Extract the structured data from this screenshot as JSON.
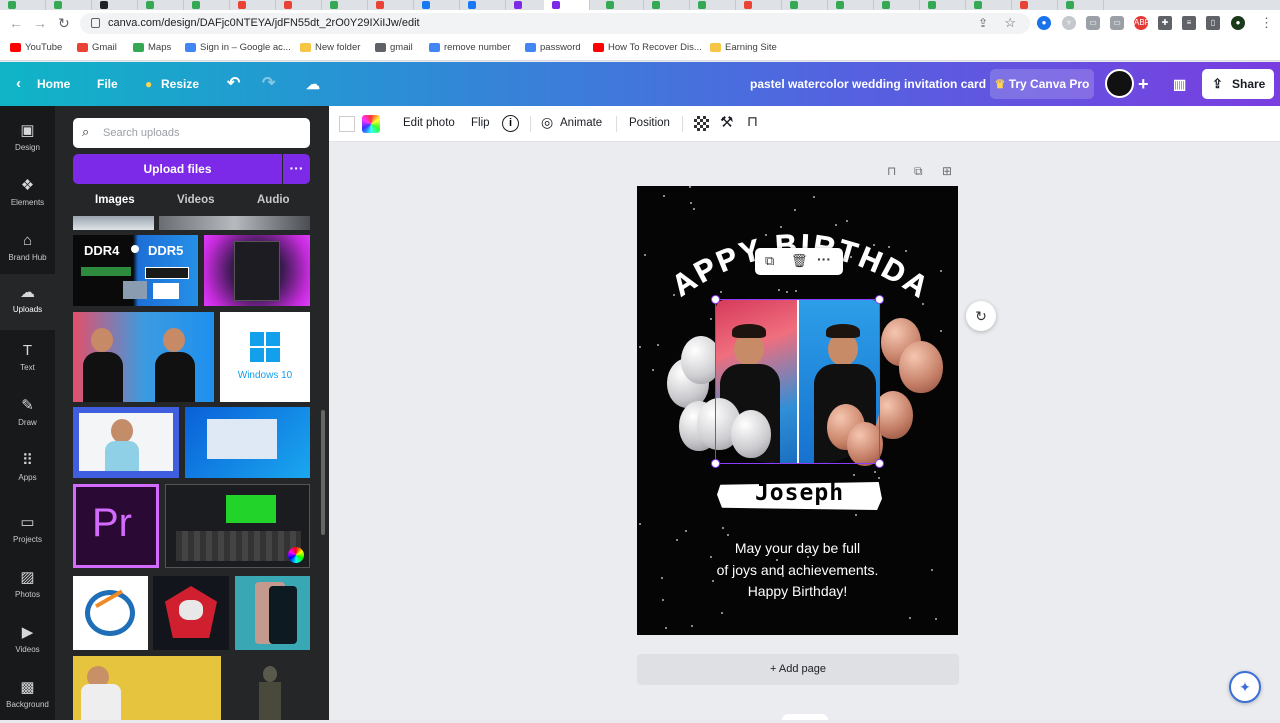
{
  "browser": {
    "url": "canva.com/design/DAFjc0NTEYA/jdFN55dt_2rO0Y29IXiIJw/edit",
    "bookmarks": [
      {
        "label": "YouTube",
        "color": "#ff0000"
      },
      {
        "label": "Gmail",
        "color": "#ea4335"
      },
      {
        "label": "Maps",
        "color": "#34a853"
      },
      {
        "label": "Sign in – Google ac...",
        "color": "#4285f4"
      },
      {
        "label": "New folder",
        "color": "#f6c543"
      },
      {
        "label": "gmail",
        "color": "#5f6368"
      },
      {
        "label": "remove number",
        "color": "#4285f4"
      },
      {
        "label": "password",
        "color": "#4285f4"
      },
      {
        "label": "How To Recover Dis...",
        "color": "#ff0000"
      },
      {
        "label": "Earning Site",
        "color": "#f6c543"
      }
    ]
  },
  "header": {
    "home": "Home",
    "file": "File",
    "resize": "Resize",
    "title": "pastel watercolor wedding invitation card",
    "try_pro": "Try Canva Pro",
    "share": "Share"
  },
  "rail": [
    {
      "label": "Design",
      "icon": "layout-icon",
      "glyph": "▣"
    },
    {
      "label": "Elements",
      "icon": "shapes-icon",
      "glyph": "❖"
    },
    {
      "label": "Brand Hub",
      "icon": "briefcase-icon",
      "glyph": "⌂"
    },
    {
      "label": "Uploads",
      "icon": "cloud-upload-icon",
      "glyph": "☁"
    },
    {
      "label": "Text",
      "icon": "text-icon",
      "glyph": "T"
    },
    {
      "label": "Draw",
      "icon": "pen-icon",
      "glyph": "✎"
    },
    {
      "label": "Apps",
      "icon": "grid-icon",
      "glyph": "⠿"
    },
    {
      "label": "Projects",
      "icon": "folder-icon",
      "glyph": "▭"
    },
    {
      "label": "Photos",
      "icon": "image-icon",
      "glyph": "▨"
    },
    {
      "label": "Videos",
      "icon": "video-icon",
      "glyph": "▶"
    },
    {
      "label": "Background",
      "icon": "pattern-icon",
      "glyph": "▩"
    }
  ],
  "panel": {
    "search_placeholder": "Search uploads",
    "upload_button": "Upload files",
    "tabs": [
      "Images",
      "Videos",
      "Audio"
    ],
    "thumb_text": {
      "ddr_left": "DDR4",
      "ddr_right": "DDR5",
      "windows": "Windows 10",
      "premiere": "Pr"
    }
  },
  "context_toolbar": {
    "edit_photo": "Edit photo",
    "flip": "Flip",
    "animate": "Animate",
    "position": "Position"
  },
  "card": {
    "arc_text": "HAPPY BIRTHDAY",
    "name": "Joseph",
    "greeting_lines": [
      "May your day be full",
      "of joys and achievements.",
      "Happy Birthday!"
    ]
  },
  "canvas": {
    "add_page": "+ Add page"
  },
  "colors": {
    "accent_purple": "#7d2ae8",
    "header_start": "#0fb5c6",
    "header_end": "#7a3de0"
  }
}
